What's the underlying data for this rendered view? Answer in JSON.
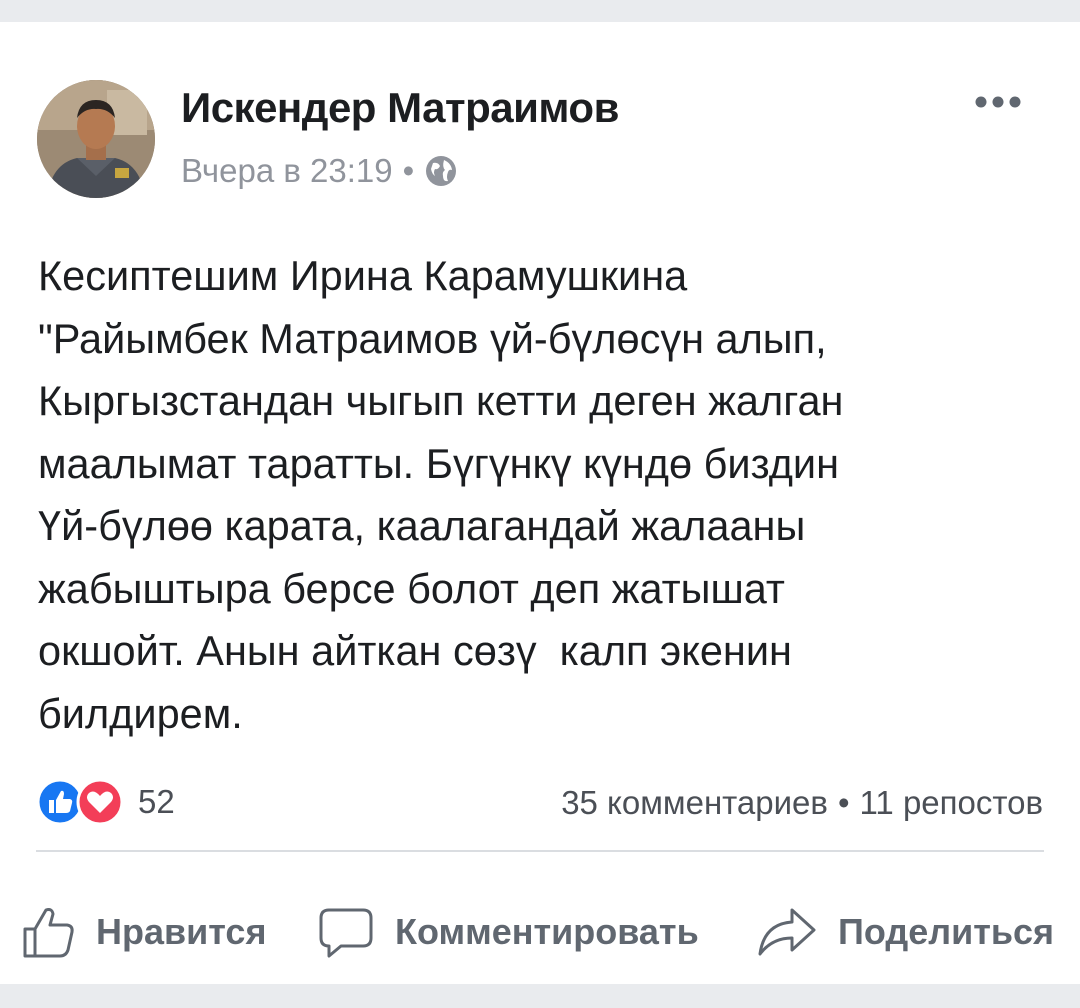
{
  "post": {
    "author": "Искендер Матраимов",
    "time": "Вчера в 23:19",
    "separator": "•",
    "privacy_icon": "globe-icon",
    "text": "Кесиптешим Ирина Карамушкина\n\"Райымбек Матраимов үй-бүлөсүн алып,\nКыргызстандан чыгып кетти деген жалган\nмаалымат таратты. Бүгүнкү күндө биздин\nҮй-бүлөө карата, каалагандай жалааны\nжабыштыра берсе болот деп жатышат\nокшойт. Анын айткан сөзү  калп экенин\nбилдирем.",
    "reactions": {
      "icons": [
        "like-icon",
        "love-icon"
      ],
      "count": "52"
    },
    "comments": "35 комментариев",
    "shares": "11 репостов"
  },
  "actions": {
    "like_label": "Нравится",
    "comment_label": "Комментировать",
    "share_label": "Поделиться"
  },
  "colors": {
    "like_blue": "#1877f2",
    "love_red": "#f33e58",
    "muted": "#606770",
    "background": "#e9ebee"
  }
}
